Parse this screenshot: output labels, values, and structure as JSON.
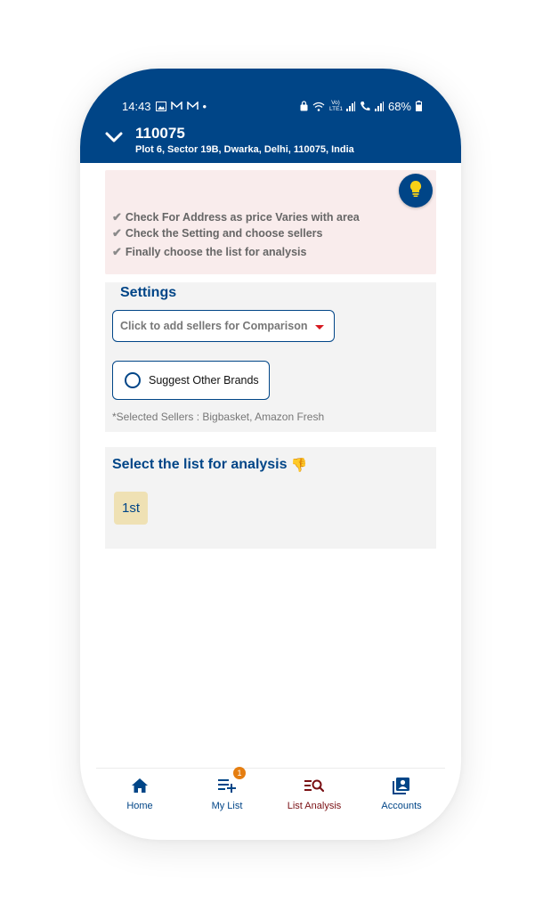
{
  "status_bar": {
    "time": "14:43",
    "dot": "•",
    "network": "Vo) LTE1",
    "battery": "68%",
    "icons": [
      "image-icon",
      "mail-icon",
      "mail-icon",
      "lock-icon",
      "wifi-icon",
      "signal-icon",
      "call-icon",
      "signal-icon",
      "battery-icon"
    ]
  },
  "header": {
    "pincode": "110075",
    "address": "Plot 6, Sector 19B, Dwarka, Delhi, 110075, India",
    "expand_icon": "chevron-down-icon",
    "color": "#004587"
  },
  "tips": {
    "items": [
      "Check For Address as price Varies with area",
      "Check the Setting and choose sellers",
      "Finally choose the list for analysis"
    ],
    "check_glyph": "✔",
    "bulb_icon": "lightbulb-icon",
    "bulb_color": "#f7d117",
    "background": "#f9ecec"
  },
  "settings": {
    "title": "Settings",
    "seller_dropdown": "Click to add sellers for Comparison",
    "suggest_brands": "Suggest Other Brands",
    "selected_sellers": "*Selected Sellers : Bigbasket, Amazon Fresh",
    "caret_color": "#d71920"
  },
  "analysis": {
    "title": "Select the list for analysis",
    "emoji": "👎",
    "lists": [
      "1st"
    ],
    "chip_color": "#efe1b4"
  },
  "bottom_nav": {
    "items": [
      {
        "label": "Home",
        "icon": "home-icon"
      },
      {
        "label": "My List",
        "icon": "playlist-add-icon",
        "badge": "1"
      },
      {
        "label": "List Analysis",
        "icon": "list-search-icon",
        "active": true
      },
      {
        "label": "Accounts",
        "icon": "account-box-icon"
      }
    ],
    "active_color": "#7a1014",
    "badge_color": "#e57e11"
  }
}
